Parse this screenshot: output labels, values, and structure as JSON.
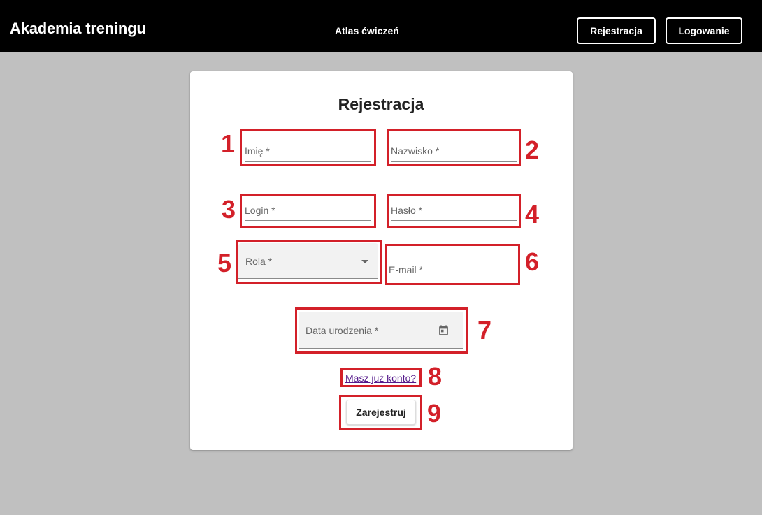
{
  "header": {
    "brand": "Akademia treningu",
    "nav_link": "Atlas ćwiczeń",
    "register_button": "Rejestracja",
    "login_button": "Logowanie"
  },
  "form": {
    "title": "Rejestracja",
    "first_name_label": "Imię *",
    "last_name_label": "Nazwisko *",
    "login_label": "Login *",
    "password_label": "Hasło *",
    "role_label": "Rola *",
    "email_label": "E-mail *",
    "birthdate_label": "Data urodzenia *",
    "account_link": "Masz już konto?",
    "submit_button": "Zarejestruj"
  },
  "annotations": [
    "1",
    "2",
    "3",
    "4",
    "5",
    "6",
    "7",
    "8",
    "9"
  ],
  "colors": {
    "header_bg": "#000000",
    "page_bg": "#c0c0c0",
    "annotation": "#d32029",
    "link": "#551a8b"
  }
}
